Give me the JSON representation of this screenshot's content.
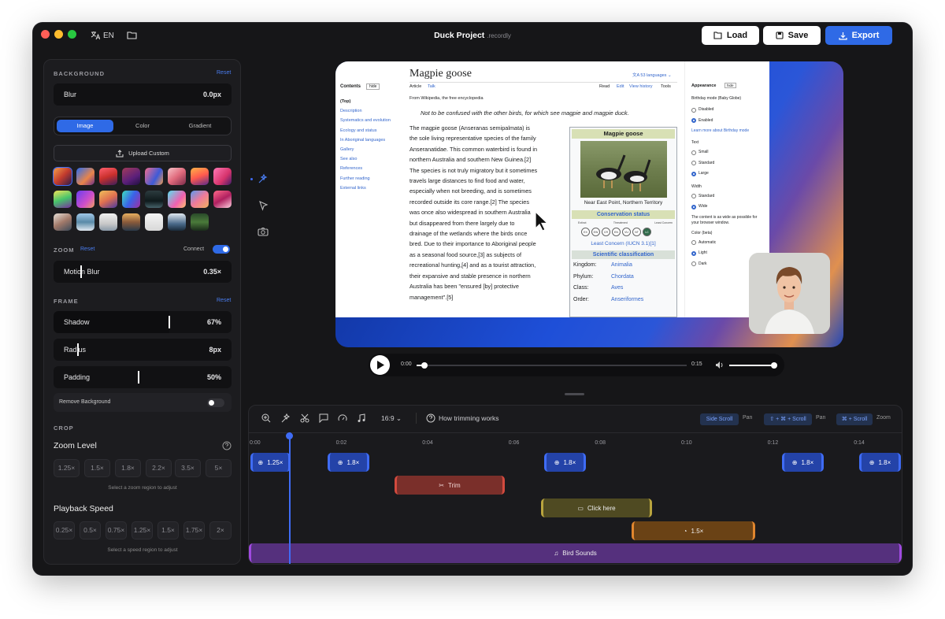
{
  "titlebar": {
    "lang": "EN",
    "project_name": "Duck Project",
    "project_ext": ".recordly",
    "load": "Load",
    "save": "Save",
    "export": "Export"
  },
  "panel": {
    "background": {
      "title": "BACKGROUND",
      "reset": "Reset",
      "blur_label": "Blur",
      "blur_value": "0.0px",
      "tabs": [
        "Image",
        "Color",
        "Gradient"
      ],
      "active_tab": "Image",
      "upload": "Upload Custom"
    },
    "zoom": {
      "title": "ZOOM",
      "reset": "Reset",
      "connect": "Connect",
      "motion_label": "Motion Blur",
      "motion_value": "0.35×"
    },
    "frame": {
      "title": "FRAME",
      "reset": "Reset",
      "shadow_label": "Shadow",
      "shadow_value": "67%",
      "radius_label": "Radius",
      "radius_value": "8px",
      "padding_label": "Padding",
      "padding_value": "50%",
      "remove_bg": "Remove Background"
    },
    "crop": {
      "title": "CROP"
    },
    "zoom_level": {
      "title": "Zoom Level",
      "options": [
        "1.25×",
        "1.5×",
        "1.8×",
        "2.2×",
        "3.5×",
        "5×"
      ],
      "hint": "Select a zoom region to adjust"
    },
    "playback": {
      "title": "Playback Speed",
      "options": [
        "0.25×",
        "0.5×",
        "0.75×",
        "1.25×",
        "1.5×",
        "1.75×",
        "2×"
      ],
      "hint": "Select a speed region to adjust"
    }
  },
  "wiki": {
    "title": "Magpie goose",
    "languages": "53 languages",
    "tabs": [
      "Article",
      "Talk"
    ],
    "actions": [
      "Read",
      "Edit",
      "View history",
      "Tools"
    ],
    "from": "From Wikipedia, the free encyclopedia",
    "hatnote": "Not to be confused with the other birds, for which see magpie and magpie duck.",
    "contents_title": "Contents",
    "contents_hide": "hide",
    "contents": [
      "(Top)",
      "Description",
      "Systematics and evolution",
      "Ecology and status",
      "In Aboriginal languages",
      "Gallery",
      "See also",
      "References",
      "Further reading",
      "External links"
    ],
    "body": [
      "The magpie goose (Anseranas semipalmata) is",
      "the sole living representative species of the family",
      "Anseranatidae. This common waterbird is found in",
      "northern Australia and southern New Guinea.[2]",
      "The species is not truly migratory but it sometimes",
      "travels large distances to find food and water,",
      "especially when not breeding, and is sometimes",
      "recorded outside its core range.[2] The species",
      "was once also widespread in southern Australia",
      "but disappeared from there largely due to",
      "drainage of the wetlands where the birds once",
      "bred. Due to their importance to Aboriginal people",
      "as a seasonal food source,[3] as subjects of",
      "recreational hunting,[4] and as a tourist attraction,",
      "their expansive and stable presence in northern",
      "Australia has been \"ensured [by] protective",
      "management\".[5]"
    ],
    "infobox": {
      "title": "Magpie goose",
      "caption": "Near East Point, Northern Territory",
      "conservation": "Conservation status",
      "status_scale": [
        "Extinct",
        "Threatened",
        "Least Concern"
      ],
      "statuses": [
        "EX",
        "EW",
        "CR",
        "EN",
        "VU",
        "NT",
        "LC"
      ],
      "lc": "Least Concern (IUCN 3.1)[1]",
      "sci": "Scientific classification",
      "rows": [
        [
          "Kingdom:",
          "Animalia"
        ],
        [
          "Phylum:",
          "Chordata"
        ],
        [
          "Class:",
          "Aves"
        ],
        [
          "Order:",
          "Anseriformes"
        ]
      ]
    },
    "appearance": {
      "title": "Appearance",
      "hide": "hide",
      "birthday": "Birthday mode (Baby Globe)",
      "birthday_opts": [
        "Disabled",
        "Enabled"
      ],
      "learn": "Learn more about Birthday mode",
      "text": "Text",
      "text_opts": [
        "Small",
        "Standard",
        "Large"
      ],
      "width": "Width",
      "width_opts": [
        "Standard",
        "Wide"
      ],
      "width_note": "The content is as wide as possible for your browser window.",
      "color": "Color (beta)",
      "color_opts": [
        "Automatic",
        "Light",
        "Dark"
      ]
    }
  },
  "player": {
    "current": "0:00",
    "total": "0:15",
    "progress": 0.03,
    "volume": 0.95
  },
  "timeline": {
    "aspect": "16:9",
    "help": "How trimming works",
    "shortcuts": [
      {
        "key": "Side Scroll",
        "action": "Pan"
      },
      {
        "key": "⇧ + ⌘ + Scroll",
        "action": "Pan"
      },
      {
        "key": "⌘ + Scroll",
        "action": "Zoom"
      }
    ],
    "ticks": [
      "0:00",
      "0:02",
      "0:04",
      "0:06",
      "0:08",
      "0:10",
      "0:12",
      "0:14"
    ],
    "zoom_clips": [
      "1.25×",
      "1.8×",
      "1.8×",
      "1.8×",
      "1.8×"
    ],
    "trim": "Trim",
    "annotation": "Click here",
    "speed": "1.5×",
    "audio": "Bird Sounds"
  },
  "colors": {
    "accent": "#2f6ae6",
    "trim": "#7a2f2a",
    "annotation": "#4f4a22",
    "speed": "#6a4215",
    "audio": "#55307d"
  }
}
